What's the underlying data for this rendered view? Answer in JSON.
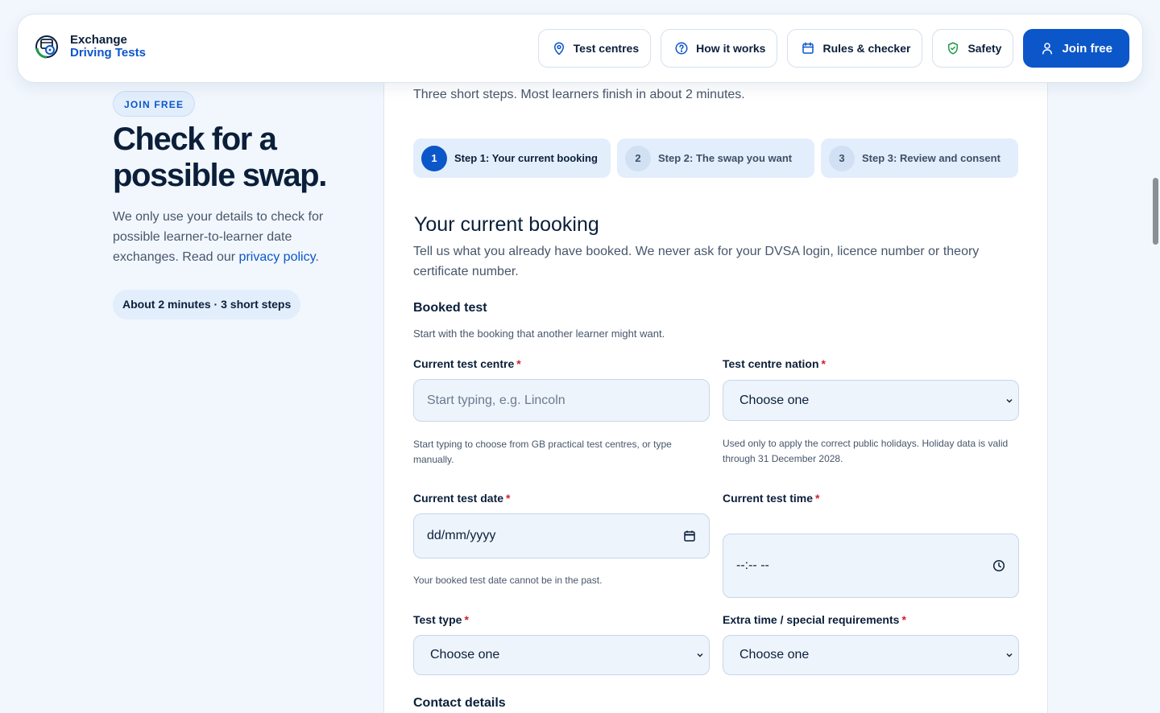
{
  "header": {
    "brand_line1": "Exchange",
    "brand_line2": "Driving Tests",
    "nav": [
      {
        "label": "Test centres",
        "icon": "map-pin-icon"
      },
      {
        "label": "How it works",
        "icon": "question-circle-icon"
      },
      {
        "label": "Rules & checker",
        "icon": "calendar-icon"
      },
      {
        "label": "Safety",
        "icon": "shield-check-icon"
      }
    ],
    "cta_label": "Join free",
    "cta_icon": "user-icon"
  },
  "hero": {
    "tag": "JOIN FREE",
    "title": "Check for a possible swap.",
    "text_before_link": "We only use your details to check for possible learner-to-learner date exchanges. Read our ",
    "link_text": "privacy policy",
    "text_after_link": ".",
    "time_pill": "About 2 minutes · 3 short steps"
  },
  "form": {
    "intro": "Three short steps. Most learners finish in about 2 minutes.",
    "steps": [
      {
        "num": "1",
        "label": "Step 1: Your current booking",
        "active": true
      },
      {
        "num": "2",
        "label": "Step 2: The swap you want",
        "active": false
      },
      {
        "num": "3",
        "label": "Step 3: Review and consent",
        "active": false
      }
    ],
    "section_title": "Your current booking",
    "section_desc": "Tell us what you already have booked. We never ask for your DVSA login, licence number or theory certificate number.",
    "booked_title": "Booked test",
    "booked_desc": "Start with the booking that another learner might want.",
    "required_mark": "*",
    "fields": {
      "centre": {
        "label": "Current test centre",
        "placeholder": "Start typing, e.g. Lincoln",
        "help": "Start typing to choose from GB practical test centres, or type manually."
      },
      "nation": {
        "label": "Test centre nation",
        "value": "Choose one",
        "help": "Used only to apply the correct public holidays. Holiday data is valid through 31 December 2028."
      },
      "date": {
        "label": "Current test date",
        "value": "dd/mm/yyyy",
        "help": "Your booked test date cannot be in the past."
      },
      "time": {
        "label": "Current test time",
        "value": "--:-- --"
      },
      "type": {
        "label": "Test type",
        "value": "Choose one"
      },
      "extra": {
        "label": "Extra time / special requirements",
        "value": "Choose one"
      }
    },
    "contact_title": "Contact details"
  },
  "colors": {
    "brand": "#0b56c9",
    "background": "#f2f7fd",
    "required": "#d0212f"
  }
}
